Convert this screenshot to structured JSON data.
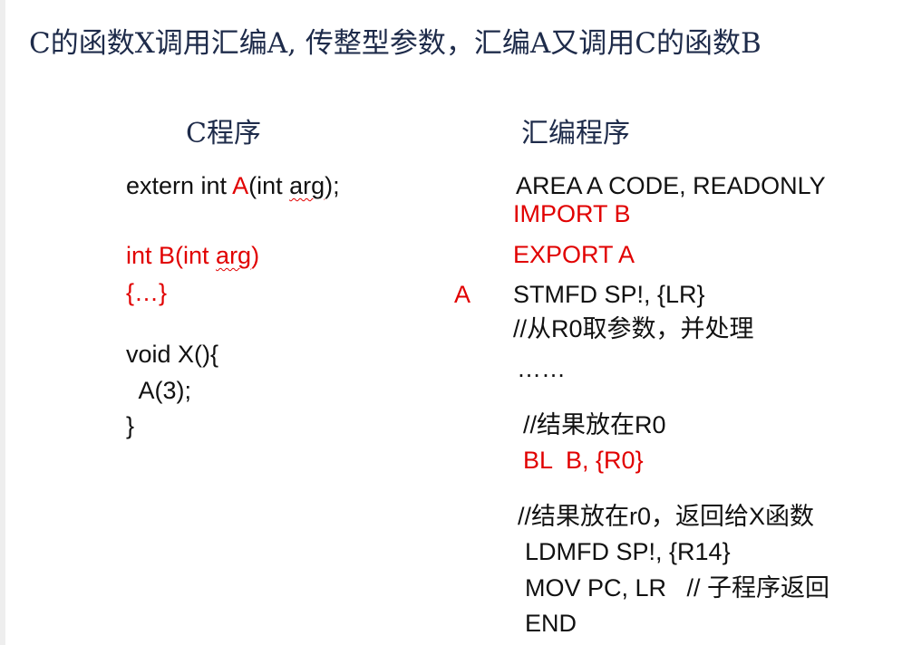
{
  "title": "C的函数X调用汇编A, 传整型参数，汇编A又调用C的函数B",
  "c_program": {
    "heading": "C程序",
    "extern_prefix": "extern int ",
    "extern_name": "A",
    "extern_params_pre": "(int ",
    "extern_arg": "arg",
    "extern_suffix": ");",
    "b_decl_pre": "int B(int ",
    "b_decl_arg": "arg",
    "b_decl_post": ")",
    "b_body": "{…}",
    "x_decl": "void X(){",
    "x_call": "  A(3);",
    "x_close": "}"
  },
  "asm_program": {
    "heading": "汇编程序",
    "area": "AREA A CODE, READONLY",
    "import": "IMPORT B",
    "export": "EXPORT A",
    "label": "A",
    "stmfd": "STMFD SP!, {LR}",
    "comment1": "//从R0取参数，并处理",
    "ellipsis": "……",
    "comment2": "//结果放在R0",
    "bl": "BL  B, {R0}",
    "comment3": "//结果放在r0，返回给X函数",
    "ldmfd": "LDMFD SP!, {R14}",
    "mov": "MOV PC, LR   // 子程序返回",
    "end": "END"
  }
}
